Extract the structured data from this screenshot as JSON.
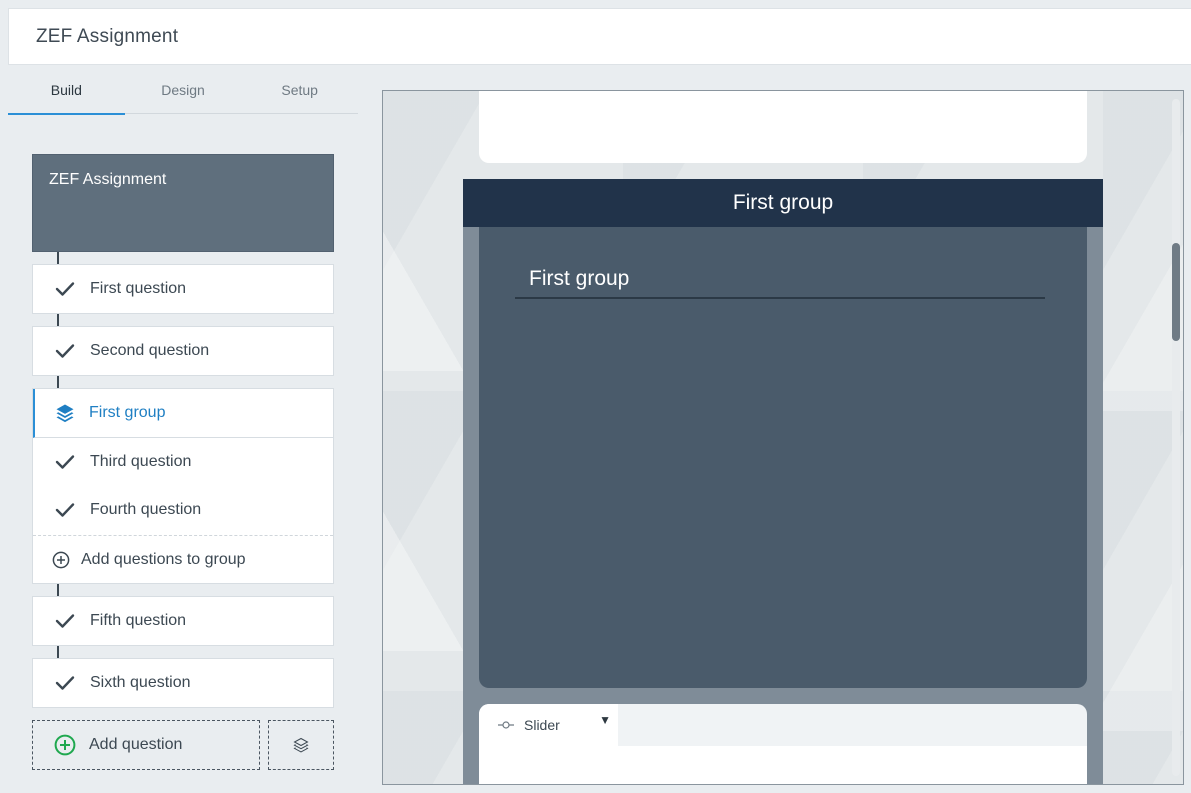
{
  "header": {
    "title": "ZEF Assignment"
  },
  "tabs": [
    {
      "label": "Build",
      "active": true
    },
    {
      "label": "Design",
      "active": false
    },
    {
      "label": "Setup",
      "active": false
    }
  ],
  "outline": {
    "title_card": "ZEF Assignment",
    "questions_before_group": [
      {
        "label": "First question",
        "icon": "check-icon"
      },
      {
        "label": "Second question",
        "icon": "check-icon"
      }
    ],
    "group": {
      "label": "First group",
      "icon": "layers-icon",
      "items": [
        {
          "label": "Third question",
          "icon": "check-icon"
        },
        {
          "label": "Fourth question",
          "icon": "check-icon"
        }
      ],
      "add_label": "Add questions to group"
    },
    "questions_after_group": [
      {
        "label": "Fifth question",
        "icon": "check-icon"
      },
      {
        "label": "Sixth question",
        "icon": "check-icon"
      }
    ],
    "add_question_label": "Add question"
  },
  "preview": {
    "group_header": "First group",
    "group_title": "First group",
    "slider_label": "Slider",
    "slider_caret": "▼"
  },
  "colors": {
    "accent": "#2b8fd6",
    "group_header_bg": "#21334a",
    "group_panel_bg": "#4a5b6b",
    "title_card_bg": "#5f6f7d",
    "add_green": "#1fa84f"
  }
}
